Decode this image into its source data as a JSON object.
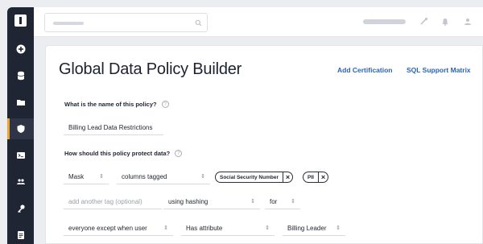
{
  "sidebar": {
    "items": [
      {
        "icon": "plus-circle-icon"
      },
      {
        "icon": "database-icon"
      },
      {
        "icon": "folder-icon"
      },
      {
        "icon": "shield-icon",
        "active": true
      },
      {
        "icon": "terminal-icon"
      },
      {
        "icon": "users-icon"
      },
      {
        "icon": "key-icon"
      },
      {
        "icon": "document-icon"
      }
    ]
  },
  "header": {
    "icons": [
      "search-icon",
      "link-icon",
      "bell-icon",
      "user-icon"
    ]
  },
  "main": {
    "title": "Global Data Policy Builder",
    "links": {
      "add_certification": "Add Certification",
      "sql_support_matrix": "SQL Support Matrix"
    },
    "policy_name": {
      "question": "What is the name of this policy?",
      "value": "Billing Lead Data Restrictions"
    },
    "protect": {
      "question": "How should this policy protect data?",
      "row1": {
        "action": "Mask",
        "target": "columns tagged",
        "tags": [
          "Social Security Number",
          "PII"
        ]
      },
      "row2": {
        "tag_placeholder": "add another tag (optional)",
        "method": "using hashing",
        "for": "for"
      },
      "row3": {
        "who": "everyone except when user",
        "condition": "Has attribute",
        "attribute": "Billing Leader"
      }
    }
  },
  "colors": {
    "sidebar": "#1f2533",
    "active_accent": "#e7a43a",
    "link": "#2a63b3"
  }
}
